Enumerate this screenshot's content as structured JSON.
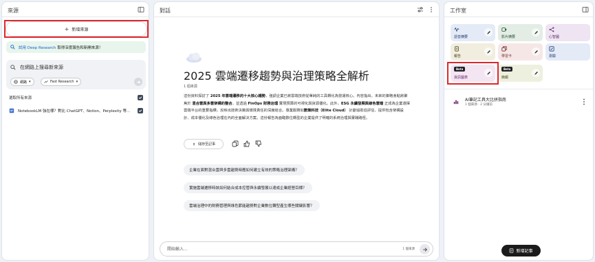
{
  "sources": {
    "title": "來源",
    "add_label": "新增來源",
    "promo_highlight": "試用 Deep Research",
    "promo_text": "取得深度報告和新開來源！",
    "web_search_placeholder": "在網路上搜尋新來源",
    "chip_web": "網路",
    "chip_research": "Fast Research",
    "select_all": "選取所有來源",
    "items": [
      {
        "title": "NotebookLM 強在哪？對比 ChatGPT、Notion、Perplexity 等…",
        "checked": true
      }
    ]
  },
  "chat": {
    "title": "對話",
    "doc_title": "2025 雲端遷移趨勢與治理策略全解析",
    "doc_meta": "1 個來源",
    "body_parts": [
      "這份資料探討了 ",
      "2025 年雲端遷移的十大核心趨勢",
      "，強調企業已將雲端技術從單純的工具轉化為營運核心。內容指出，未來的策略會點將聚焦於 ",
      "混合雲與多雲架構的整合",
      "，並透過 ",
      "FinOps 財務治理",
      " 實現預算的可視化與資源優化。此外，",
      "ESG 永續發展與綠色雲端",
      " 正成為企業選擇雲端平台的重要指標，反映出技術決策與環境責任的深度結合。專業服務如",
      "數策科技（Elite Cloud）",
      " 計劃協助從評估、提供包含架構設計、成本優化及綠色治理在內的全面解決方案。這份報告為面臨數位轉型的企業提供了明確的系統治理與實踐路徑。"
    ],
    "save_note_label": "儲存至記事",
    "suggestions": [
      "企業在面對混合雲與多雲趨勢時應如何建立有效的策略治理架構？",
      "實施雲端遷移時該如何結合成本控管與永續發展以達成企業經營目標？",
      "雲端治理中的財務管理與綠色節能趨勢對企業數位轉型產生哪些關鍵影響？"
    ],
    "input_placeholder": "開始輸入...",
    "source_count": "1 個來源"
  },
  "studio": {
    "title": "工作室",
    "tiles": [
      {
        "label": "語音摘要",
        "bg": "#e4ebf7",
        "fg": "#1d3a6e",
        "icon": "waveform-icon"
      },
      {
        "label": "影片摘要",
        "bg": "#e3ede6",
        "fg": "#1f4d2e",
        "icon": "video-icon"
      },
      {
        "label": "心智圖",
        "bg": "#efe4f2",
        "fg": "#5a2a6a",
        "icon": "mindmap-icon"
      },
      {
        "label": "報告",
        "bg": "#f1eee0",
        "fg": "#4f4317",
        "icon": "report-icon"
      },
      {
        "label": "學習卡",
        "bg": "#f6e7e7",
        "fg": "#6a2323",
        "icon": "flashcard-icon"
      },
      {
        "label": "測驗",
        "bg": "#e4ebf7",
        "fg": "#1d3a6e",
        "icon": "quiz-icon"
      },
      {
        "label": "資訊圖表",
        "bg": "#f3e5f2",
        "fg": "#6a2466",
        "icon": "infographic-icon",
        "beta": "Beta"
      },
      {
        "label": "簡報",
        "bg": "#eef0df",
        "fg": "#4a4a1a",
        "icon": "slides-icon",
        "beta": "Beta"
      }
    ],
    "note_title": "AI筆記工具大比拼指南",
    "note_meta": "1 個來源 · 2 分鐘前",
    "add_note_label": "新增記事"
  }
}
